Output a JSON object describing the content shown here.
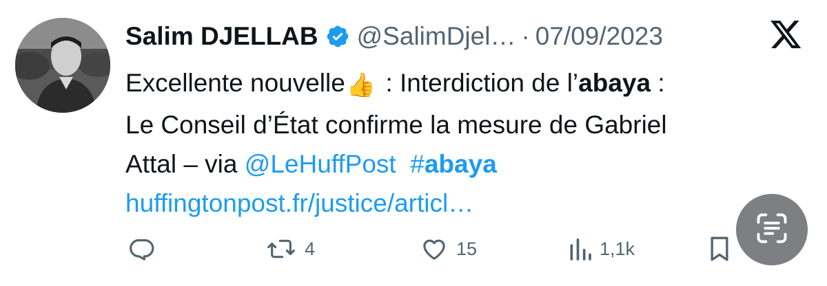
{
  "tweet": {
    "author": {
      "display_name": "Salim DJELLAB",
      "handle": "@SalimDjel…",
      "verified_icon": "verified-badge-icon"
    },
    "separator": "·",
    "date": "07/09/2023",
    "platform_icon": "x-logo-icon",
    "text": {
      "line1_a": "Excellente nouvelle",
      "line1_emoji": "👍",
      "line1_b": " : Interdiction de l’",
      "line1_bold": "abaya",
      "line1_c": " :",
      "line2": "Le Conseil d’État confirme la mesure de Gabriel",
      "line3_a": "Attal – via ",
      "line3_mention": "@LeHuffPost",
      "line3_hashtag_prefix": "#",
      "line3_hashtag": "abaya",
      "line4_link": "huffingtonpost.fr/justice/articl…"
    },
    "actions": {
      "reply_count": "",
      "retweet_count": "4",
      "like_count": "15",
      "views_count": "1,1k"
    },
    "colors": {
      "link": "#1d9bf0",
      "secondary_text": "#536471",
      "primary_text": "#0f1419",
      "scan_button_bg": "#7d7f83"
    }
  }
}
